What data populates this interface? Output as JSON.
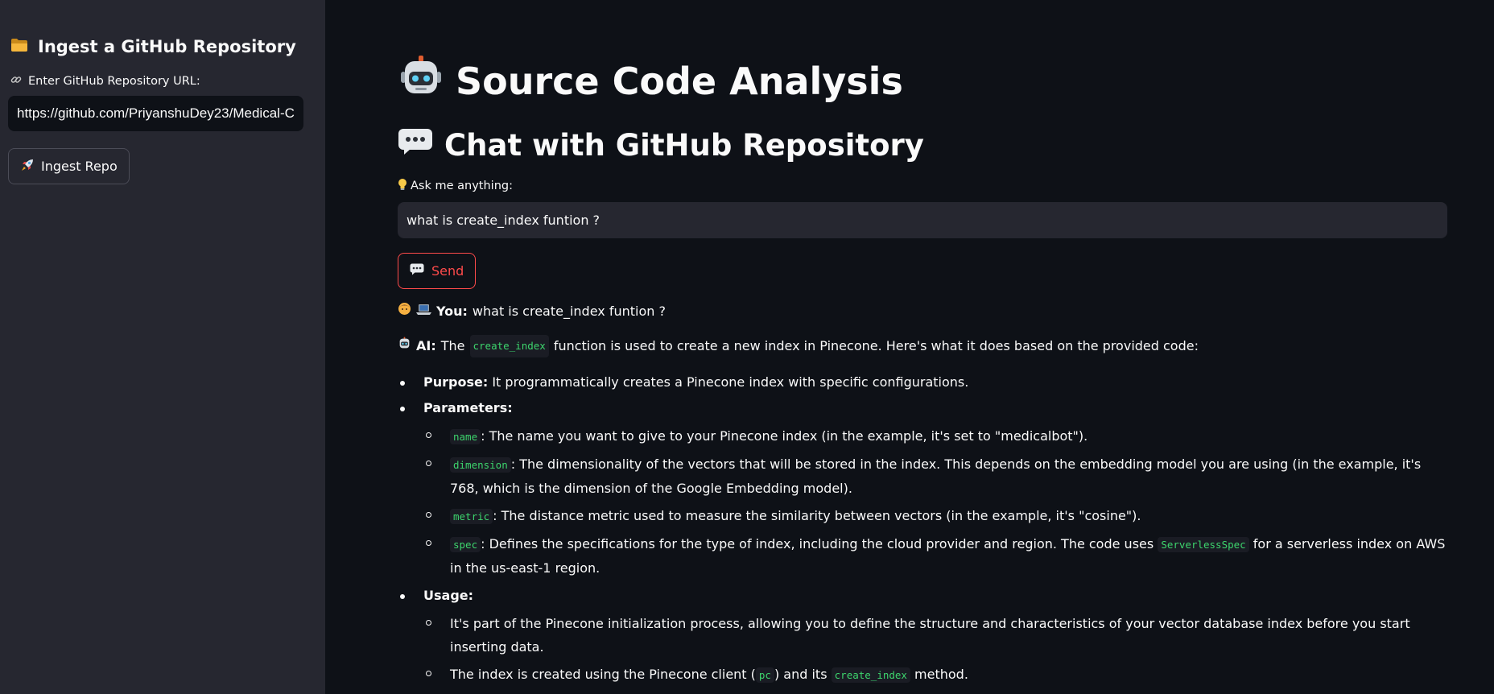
{
  "sidebar": {
    "title": "Ingest a GitHub Repository",
    "title_icon": "folder-icon",
    "url_label": "Enter GitHub Repository URL:",
    "url_label_icon": "link-icon",
    "url_value": "https://github.com/PriyanshuDey23/Medical-C",
    "ingest_button": "Ingest Repo",
    "ingest_icon": "rocket-icon"
  },
  "main": {
    "title": "Source Code Analysis",
    "subtitle": "Chat with GitHub Repository",
    "ask_label": "Ask me anything:",
    "ask_value": "what is create_index funtion ?",
    "send_button": "Send",
    "accent_color": "#ff4b4b",
    "code_color": "#3dd56d"
  },
  "chat": {
    "you_label": "You:",
    "you_text": "what is create_index funtion ?",
    "ai_label": "AI:",
    "ai_intro_pre": "The",
    "ai_intro_code": "create_index",
    "ai_intro_post": "function is used to create a new index in Pinecone. Here's what it does based on the provided code:",
    "purpose_label": "Purpose:",
    "purpose_text": "It programmatically creates a Pinecone index with specific configurations.",
    "parameters_label": "Parameters:",
    "p_name_code": "name",
    "p_name_text": ": The name you want to give to your Pinecone index (in the example, it's set to \"medicalbot\").",
    "p_dim_code": "dimension",
    "p_dim_text": ": The dimensionality of the vectors that will be stored in the index. This depends on the embedding model you are using (in the example, it's 768, which is the dimension of the Google Embedding model).",
    "p_metric_code": "metric",
    "p_metric_text": ": The distance metric used to measure the similarity between vectors (in the example, it's \"cosine\").",
    "p_spec_code": "spec",
    "p_spec_text1": ": Defines the specifications for the type of index, including the cloud provider and region. The code uses",
    "p_spec_code2": "ServerlessSpec",
    "p_spec_text2": "for a serverless index on AWS in the us-east-1 region.",
    "usage_label": "Usage:",
    "usage_1": "It's part of the Pinecone initialization process, allowing you to define the structure and characteristics of your vector database index before you start inserting data.",
    "usage_2_pre": "The index is created using the Pinecone client (",
    "usage_2_code1": "pc",
    "usage_2_mid": ") and its",
    "usage_2_code2": "create_index",
    "usage_2_post": "method."
  }
}
